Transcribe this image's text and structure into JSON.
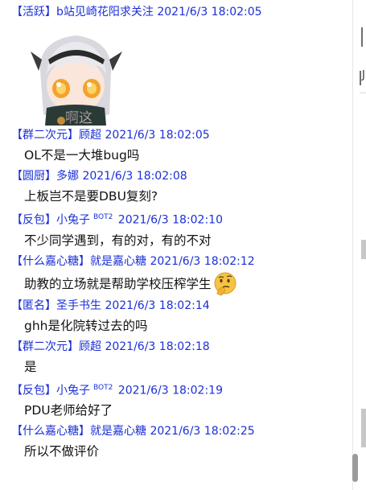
{
  "messages": [
    {
      "tag": "【活跃】",
      "name": "b站见崎花阳求关注",
      "time": "2021/6/3 18:02:05",
      "sticker_caption": "啊这"
    },
    {
      "tag": "【群二次元】",
      "name": "顾超",
      "time": "2021/6/3 18:02:05",
      "text": "OL不是一大堆bug吗"
    },
    {
      "tag": "【圆厨】",
      "name": "多娜",
      "time": "2021/6/3 18:02:08",
      "text": "上板岂不是要DBU复刻?"
    },
    {
      "tag": "【反包】",
      "name": "小兔子",
      "badge": "BOT2",
      "time": "2021/6/3 18:02:10",
      "text": "不少同学遇到，有的对，有的不对"
    },
    {
      "tag": "【什么嘉心糖】",
      "name": "就是嘉心糖",
      "time": "2021/6/3 18:02:12",
      "text": "助教的立场就是帮助学校压榨学生",
      "emoji": "thinking-face-icon"
    },
    {
      "tag": "【匿名】",
      "name": "圣手书生",
      "time": "2021/6/3 18:02:14",
      "text": "ghh是化院转过去的吗"
    },
    {
      "tag": "【群二次元】",
      "name": "顾超",
      "time": "2021/6/3 18:02:18",
      "text": "是"
    },
    {
      "tag": "【反包】",
      "name": "小兔子",
      "badge": "BOT2",
      "time": "2021/6/3 18:02:19",
      "text": "PDU老师给好了"
    },
    {
      "tag": "【什么嘉心糖】",
      "name": "就是嘉心糖",
      "time": "2021/6/3 18:02:25",
      "text": "所以不做评价"
    }
  ],
  "side_fragment": "J",
  "colors": {
    "header": "#1a2fd6",
    "text": "#111111",
    "scroll_thumb": "#9b9b9b"
  }
}
